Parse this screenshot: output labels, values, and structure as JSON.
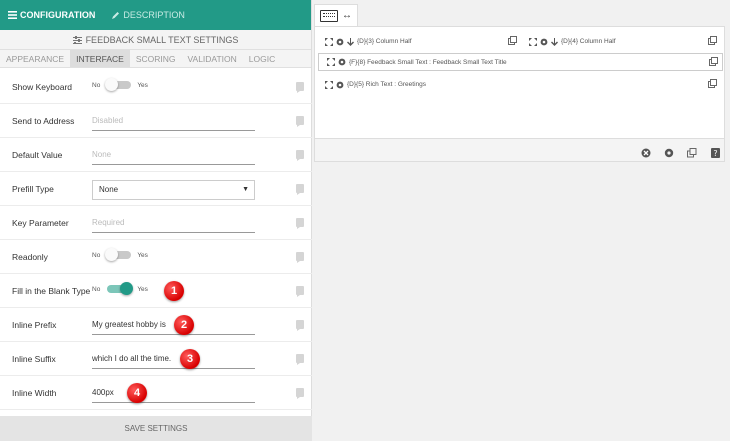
{
  "header": {
    "tabs": [
      {
        "label": "CONFIGURATION",
        "icon": "menu-icon",
        "active": true
      },
      {
        "label": "DESCRIPTION",
        "icon": "edit-icon",
        "active": false
      }
    ],
    "accent": "#229a87"
  },
  "settings_title": "FEEDBACK SMALL TEXT SETTINGS",
  "subtabs": [
    "APPEARANCE",
    "INTERFACE",
    "SCORING",
    "VALIDATION",
    "LOGIC"
  ],
  "active_subtab": "INTERFACE",
  "rows": {
    "show_keyboard": {
      "label": "Show Keyboard",
      "off": "No",
      "on": "Yes",
      "checked": false
    },
    "send_to_address": {
      "label": "Send to Address",
      "placeholder": "Disabled"
    },
    "default_value": {
      "label": "Default Value",
      "placeholder": "None"
    },
    "prefill_type": {
      "label": "Prefill Type",
      "value": "None"
    },
    "key_parameter": {
      "label": "Key Parameter",
      "placeholder": "Required"
    },
    "readonly": {
      "label": "Readonly",
      "off": "No",
      "on": "Yes",
      "checked": false
    },
    "fill_blank": {
      "label": "Fill in the Blank Type",
      "off": "No",
      "on": "Yes",
      "checked": true
    },
    "inline_prefix": {
      "label": "Inline Prefix",
      "value": "My greatest hobby is"
    },
    "inline_suffix": {
      "label": "Inline Suffix",
      "value": "which I do all the time."
    },
    "inline_width": {
      "label": "Inline Width",
      "value": "400px"
    }
  },
  "save_label": "SAVE SETTINGS",
  "markers": [
    "1",
    "2",
    "3",
    "4"
  ],
  "canvas": {
    "components": [
      {
        "text": "{D}{3} Column Half"
      },
      {
        "text": "{D}{4} Column Half"
      },
      {
        "text": "{F}{8} Feedback Small Text : Feedback Small Text Title"
      },
      {
        "text": "{D}{5} Rich Text : Greetings"
      }
    ]
  }
}
